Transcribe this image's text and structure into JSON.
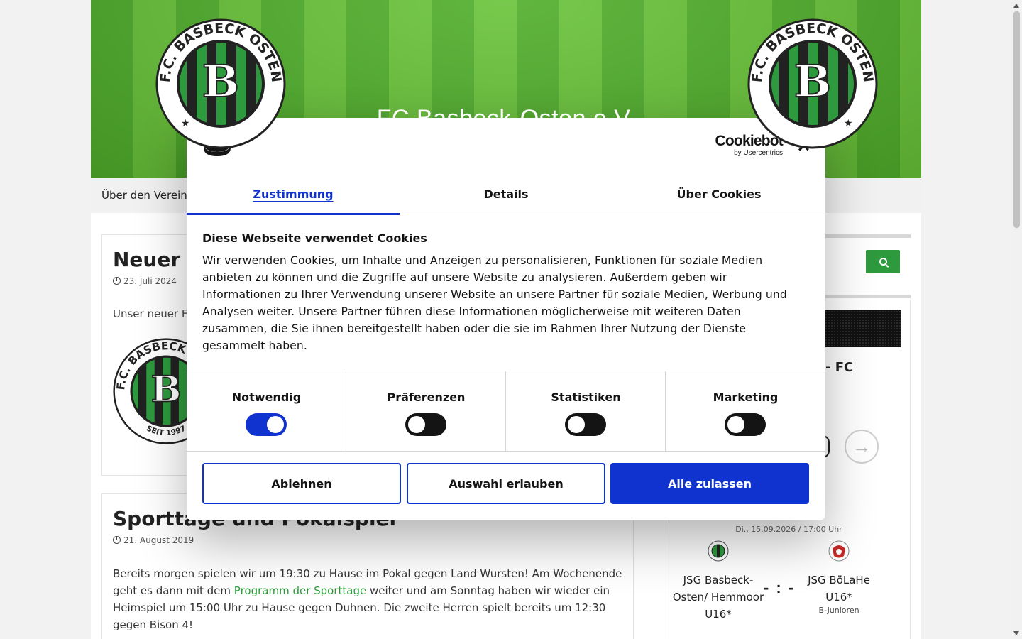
{
  "site": {
    "title": "FC Basbeck-Osten e.V.",
    "crest_text": "F.C. BASBECK OSTEN",
    "crest_year": "SEIT 1997",
    "nav": {
      "first_item": "Über den Verein"
    }
  },
  "posts": [
    {
      "title": "Neuer F",
      "date": "23. Juli 2024",
      "excerpt": "Unser neuer Fa"
    },
    {
      "title": "Sporttage und Pokalspiel",
      "date": "21. August 2019",
      "body_1": "Bereits morgen spielen wir um 19:30 zu Hause im Pokal gegen Land Wursten! Am Wochenende geht es dann mit dem ",
      "link": "Programm der Sporttage",
      "body_2": " weiter und am Sonntag haben wir wieder ein Heimspiel um 15:00 Uhr zu Hause gegen Duhnen. Die zweite Herren spielt bereits um 12:30 gegen Bison 4!"
    }
  ],
  "sidebar": {
    "widget_fragment": "- FC",
    "match": {
      "date": "Di., 15.09.2026 / 17:00 Uhr",
      "home": "JSG Basbeck-Osten/ Hemmoor U16*",
      "away": "JSG BöLaHe U16*",
      "score": "- : -",
      "league": "B-Junioren"
    }
  },
  "cookie_dialog": {
    "brand": "Cookiebot",
    "brand_sub": "by Usercentrics",
    "tabs": [
      "Zustimmung",
      "Details",
      "Über Cookies"
    ],
    "heading": "Diese Webseite verwendet Cookies",
    "text": "Wir verwenden Cookies, um Inhalte und Anzeigen zu personalisieren, Funktionen für soziale Medien anbieten zu können und die Zugriffe auf unsere Website zu analysieren. Außerdem geben wir Informationen zu Ihrer Verwendung unserer Website an unsere Partner für soziale Medien, Werbung und Analysen weiter. Unsere Partner führen diese Informationen möglicherweise mit weiteren Daten zusammen, die Sie ihnen bereitgestellt haben oder die sie im Rahmen Ihrer Nutzung der Dienste gesammelt haben.",
    "categories": [
      {
        "label": "Notwendig",
        "enabled": true
      },
      {
        "label": "Präferenzen",
        "enabled": false
      },
      {
        "label": "Statistiken",
        "enabled": false
      },
      {
        "label": "Marketing",
        "enabled": false
      }
    ],
    "buttons": {
      "decline": "Ablehnen",
      "allow_selection": "Auswahl erlauben",
      "allow_all": "Alle zulassen"
    }
  },
  "colors": {
    "accent": "#1032cf",
    "brand_green": "#2e9a3e",
    "grass": "#5bb832"
  }
}
